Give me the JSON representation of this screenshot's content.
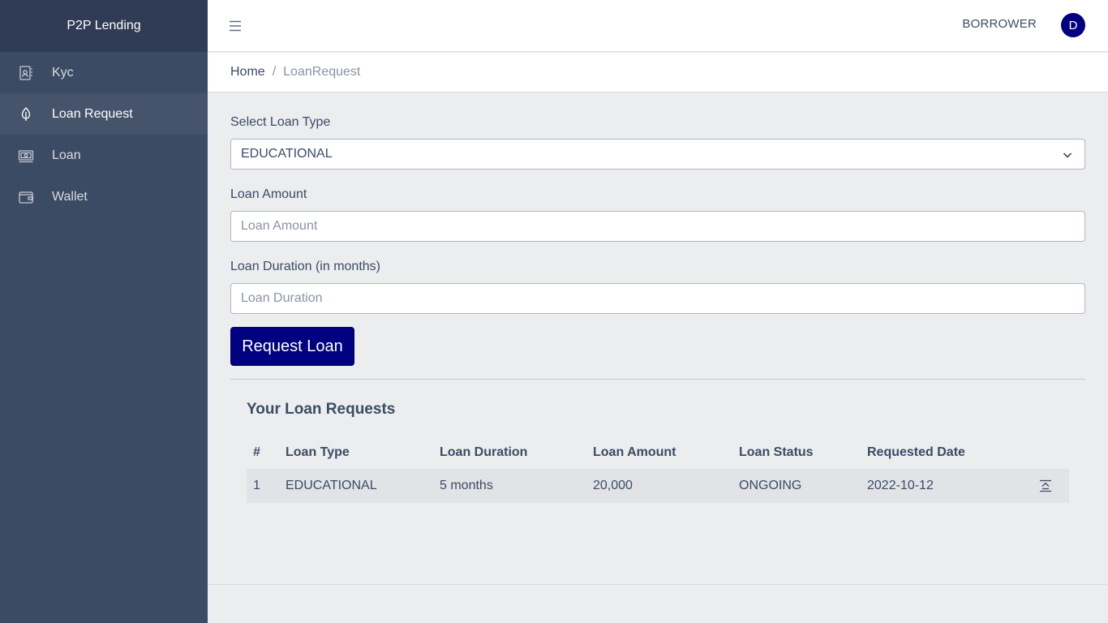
{
  "sidebar": {
    "brand": "P2P Lending",
    "items": [
      {
        "label": "Kyc",
        "icon": "contact-book-icon"
      },
      {
        "label": "Loan Request",
        "icon": "leaf-icon"
      },
      {
        "label": "Loan",
        "icon": "cash-icon"
      },
      {
        "label": "Wallet",
        "icon": "wallet-icon"
      }
    ],
    "active_index": 1
  },
  "header": {
    "role": "BORROWER",
    "avatar_initial": "D"
  },
  "breadcrumb": {
    "home": "Home",
    "separator": "/",
    "current": "LoanRequest"
  },
  "form": {
    "loan_type_label": "Select Loan Type",
    "loan_type_value": "EDUCATIONAL",
    "amount_label": "Loan Amount",
    "amount_placeholder": "Loan Amount",
    "duration_label": "Loan Duration (in months)",
    "duration_placeholder": "Loan Duration",
    "submit_label": "Request Loan"
  },
  "requests": {
    "title": "Your Loan Requests",
    "columns": [
      "#",
      "Loan Type",
      "Loan Duration",
      "Loan Amount",
      "Loan Status",
      "Requested Date"
    ],
    "rows": [
      [
        "1",
        "EDUCATIONAL",
        "5 months",
        "20,000",
        "ONGOING",
        "2022-10-12"
      ]
    ]
  },
  "colors": {
    "sidebar_bg": "#3c4b64",
    "brand_bg": "#303c54",
    "accent": "#000080",
    "page_bg": "#ebedef"
  }
}
